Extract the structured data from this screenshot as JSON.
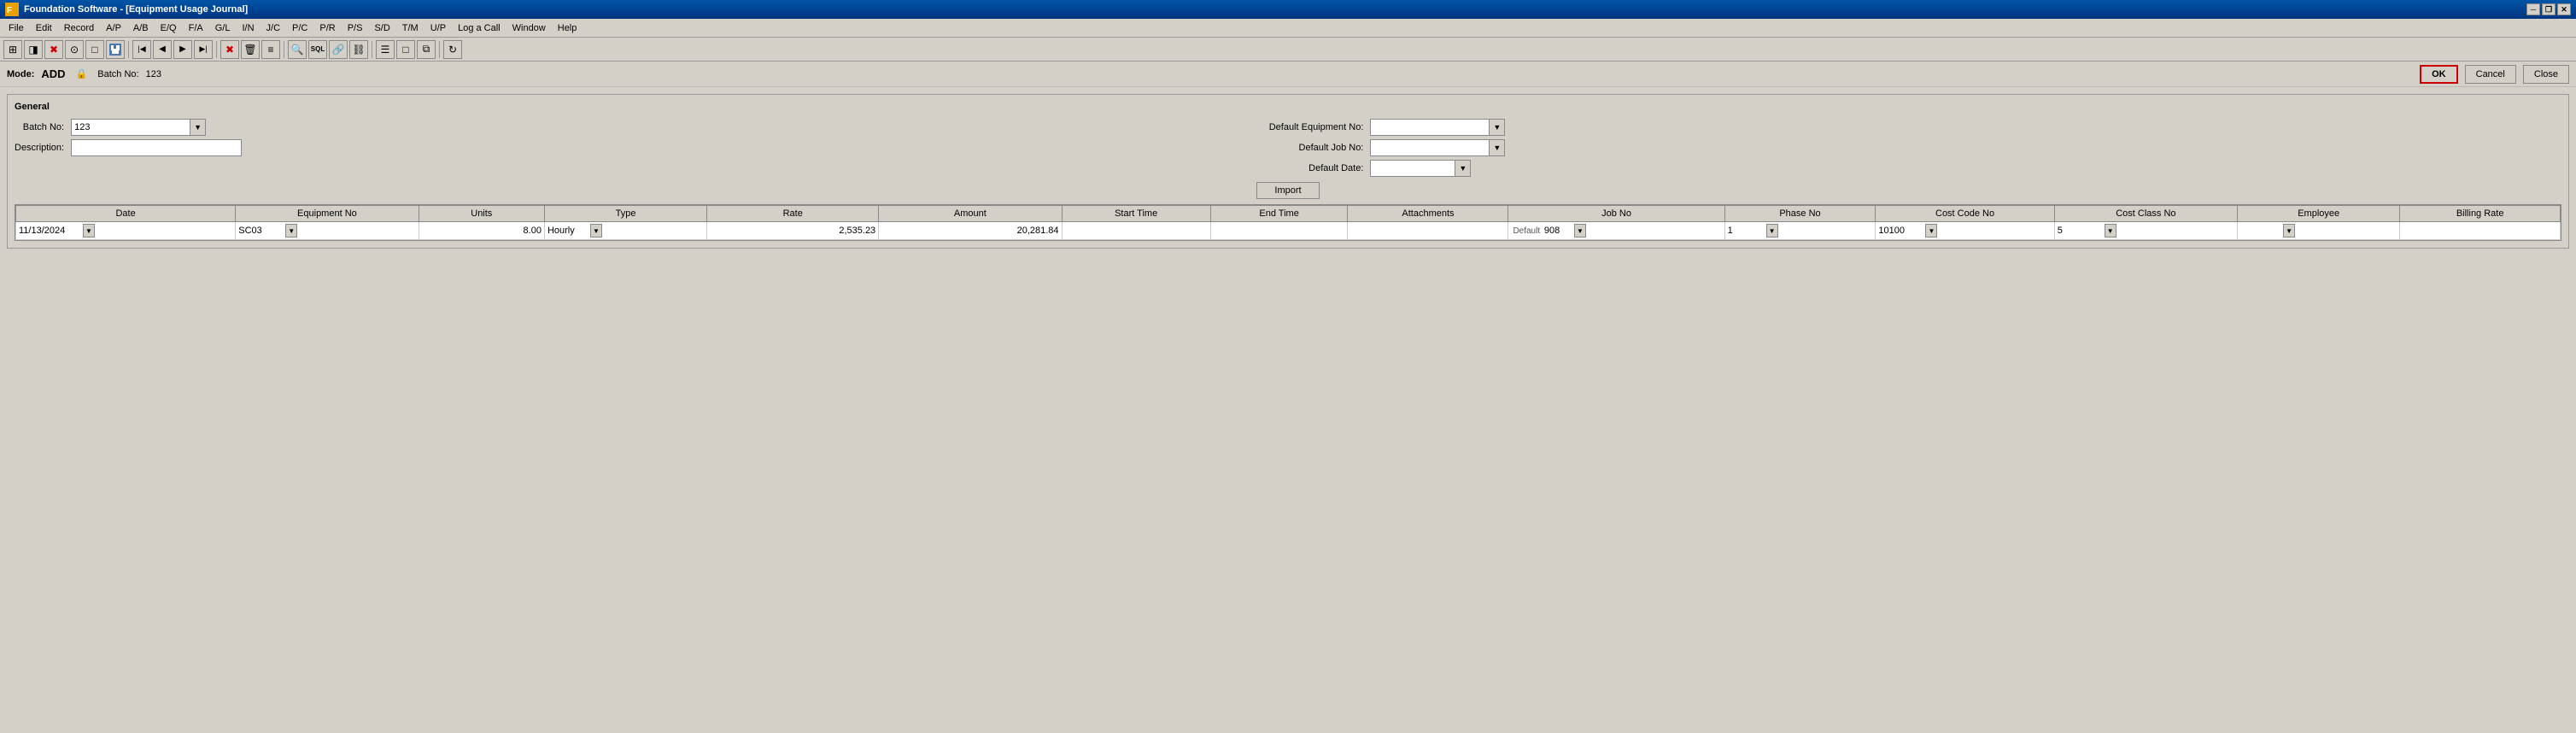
{
  "app": {
    "title": "Foundation Software - [Equipment Usage Journal]",
    "icon": "foundation-icon"
  },
  "window_controls": {
    "minimize": "─",
    "restore": "❐",
    "close": "✕"
  },
  "menu": {
    "items": [
      {
        "id": "file",
        "label": "File",
        "underline_index": 0
      },
      {
        "id": "edit",
        "label": "Edit",
        "underline_index": 0
      },
      {
        "id": "record",
        "label": "Record",
        "underline_index": 0
      },
      {
        "id": "ap",
        "label": "A/P",
        "underline_index": 0
      },
      {
        "id": "ab",
        "label": "A/B",
        "underline_index": 0
      },
      {
        "id": "eq",
        "label": "E/Q",
        "underline_index": 0
      },
      {
        "id": "fa",
        "label": "F/A",
        "underline_index": 0
      },
      {
        "id": "gl",
        "label": "G/L",
        "underline_index": 0
      },
      {
        "id": "in",
        "label": "I/N",
        "underline_index": 0
      },
      {
        "id": "jc",
        "label": "J/C",
        "underline_index": 0
      },
      {
        "id": "pc",
        "label": "P/C",
        "underline_index": 0
      },
      {
        "id": "pr",
        "label": "P/R",
        "underline_index": 0
      },
      {
        "id": "ps",
        "label": "P/S",
        "underline_index": 0
      },
      {
        "id": "sd",
        "label": "S/D",
        "underline_index": 0
      },
      {
        "id": "tm",
        "label": "T/M",
        "underline_index": 0
      },
      {
        "id": "up",
        "label": "U/P",
        "underline_index": 0
      },
      {
        "id": "logcall",
        "label": "Log a Call",
        "underline_index": 0
      },
      {
        "id": "window",
        "label": "Window",
        "underline_index": 0
      },
      {
        "id": "help",
        "label": "Help",
        "underline_index": 0
      }
    ]
  },
  "toolbar": {
    "buttons": [
      {
        "id": "grid-view",
        "icon": "⊞",
        "tooltip": "Grid View"
      },
      {
        "id": "form-view",
        "icon": "◨",
        "tooltip": "Form View"
      },
      {
        "id": "delete",
        "icon": "✖",
        "tooltip": "Delete"
      },
      {
        "id": "locate",
        "icon": "⊙",
        "tooltip": "Locate"
      },
      {
        "id": "new",
        "icon": "□",
        "tooltip": "New"
      },
      {
        "id": "save",
        "icon": "💾",
        "tooltip": "Save"
      },
      {
        "id": "first",
        "icon": "|◀",
        "tooltip": "First"
      },
      {
        "id": "prev",
        "icon": "◀",
        "tooltip": "Previous"
      },
      {
        "id": "next",
        "icon": "▶",
        "tooltip": "Next"
      },
      {
        "id": "last",
        "icon": "▶|",
        "tooltip": "Last"
      },
      {
        "id": "cancel-x",
        "icon": "✖",
        "tooltip": "Cancel"
      },
      {
        "id": "trash",
        "icon": "🗑",
        "tooltip": "Delete"
      },
      {
        "id": "detail",
        "icon": "≡",
        "tooltip": "Detail"
      },
      {
        "id": "find",
        "icon": "🔍",
        "tooltip": "Find"
      },
      {
        "id": "sql",
        "icon": "SQL",
        "tooltip": "SQL"
      },
      {
        "id": "link",
        "icon": "🔗",
        "tooltip": "Link"
      },
      {
        "id": "chain",
        "icon": "⛓",
        "tooltip": "Chain"
      },
      {
        "id": "list",
        "icon": "≡",
        "tooltip": "List"
      },
      {
        "id": "new2",
        "icon": "□",
        "tooltip": "New"
      },
      {
        "id": "copy",
        "icon": "⧉",
        "tooltip": "Copy"
      },
      {
        "id": "refresh",
        "icon": "↻",
        "tooltip": "Refresh"
      }
    ]
  },
  "mode_bar": {
    "mode_label": "Mode:",
    "mode_value": "ADD",
    "lock_icon": "🔒",
    "batch_label": "Batch No:",
    "batch_value": "123",
    "ok_label": "OK",
    "cancel_label": "Cancel",
    "close_label": "Close"
  },
  "general_panel": {
    "title": "General",
    "fields": {
      "batch_no_label": "Batch No:",
      "batch_no_value": "123",
      "description_label": "Description:",
      "description_value": "",
      "default_equip_label": "Default Equipment No:",
      "default_equip_value": "",
      "default_job_label": "Default Job No:",
      "default_job_value": "",
      "default_date_label": "Default Date:",
      "default_date_value": ""
    },
    "import_button": "Import"
  },
  "grid": {
    "columns": [
      {
        "id": "date",
        "label": "Date"
      },
      {
        "id": "equipment_no",
        "label": "Equipment No"
      },
      {
        "id": "units",
        "label": "Units"
      },
      {
        "id": "type",
        "label": "Type"
      },
      {
        "id": "rate",
        "label": "Rate"
      },
      {
        "id": "amount",
        "label": "Amount"
      },
      {
        "id": "start_time",
        "label": "Start Time"
      },
      {
        "id": "end_time",
        "label": "End Time"
      },
      {
        "id": "attachments",
        "label": "Attachments"
      },
      {
        "id": "job_no",
        "label": "Job No"
      },
      {
        "id": "phase_no",
        "label": "Phase No"
      },
      {
        "id": "cost_code_no",
        "label": "Cost Code No"
      },
      {
        "id": "cost_class_no",
        "label": "Cost Class No"
      },
      {
        "id": "employee",
        "label": "Employee"
      },
      {
        "id": "billing_rate",
        "label": "Billing Rate"
      }
    ],
    "rows": [
      {
        "date": "11/13/2024",
        "equipment_no": "SC03",
        "units": "8.00",
        "type": "Hourly",
        "rate": "2,535.23",
        "amount": "20,281.84",
        "start_time": "",
        "end_time": "",
        "attachments": "",
        "job_no": "908",
        "phase_no": "1",
        "cost_code_no": "10100",
        "cost_class_no": "5",
        "employee": "",
        "billing_rate": ""
      }
    ]
  }
}
